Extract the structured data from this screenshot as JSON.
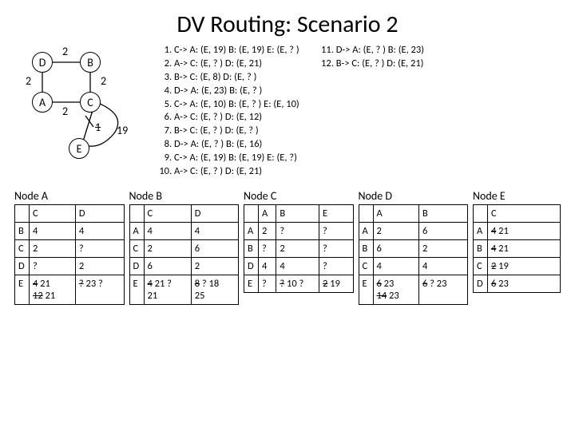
{
  "title": "DV Routing: Scenario 2",
  "graph": {
    "nodes": {
      "D": "D",
      "B": "B",
      "A": "A",
      "C": "C",
      "E": "E"
    },
    "edge_labels": {
      "DB": "2",
      "DA": "2",
      "BC": "2",
      "AC": "2",
      "CE_old": "1",
      "CE_new": "19"
    }
  },
  "steps_left": [
    "C-> A: (E, 19)  B: (E, 19)  E: (E, ? )",
    "A-> C: (E, ? )   D: (E, 21)",
    "B-> C: (E, 8)   D: (E, ? )",
    "D-> A: (E, 23)  B: (E, ? )",
    "C-> A: (E, 10)  B: (E, ? )   E: (E, 10)",
    "A-> C: (E, ? )   D: (E, 12)",
    "B-> C: (E, ? )   D: (E, ? )",
    "D-> A: (E, ? )   B: (E, 16)",
    "C-> A: (E, 19)  B: (E, 19)  E: (E, ?)",
    "A-> C: (E, ? )   D: (E, 21)"
  ],
  "steps_right": [
    "D-> A: (E, ? )   B: (E, 23)",
    "B-> C: (E, ? )   D: (E, 21)"
  ],
  "steps_right_start": 11,
  "tables": {
    "A": {
      "name": "Node A",
      "cols": [
        "C",
        "D"
      ],
      "rows": [
        {
          "h": "B",
          "cells": [
            [
              "4"
            ],
            [
              "4"
            ]
          ]
        },
        {
          "h": "C",
          "cells": [
            [
              "2"
            ],
            [
              "?"
            ]
          ]
        },
        {
          "h": "D",
          "cells": [
            [
              "?"
            ],
            [
              "2"
            ]
          ]
        },
        {
          "h": "E",
          "cells": [
            [
              "~4 21",
              "~12 21"
            ],
            [
              "~? 23 ?"
            ]
          ]
        }
      ]
    },
    "B": {
      "name": "Node B",
      "cols": [
        "C",
        "D"
      ],
      "rows": [
        {
          "h": "A",
          "cells": [
            [
              "4"
            ],
            [
              "4"
            ]
          ]
        },
        {
          "h": "C",
          "cells": [
            [
              "2"
            ],
            [
              "6"
            ]
          ]
        },
        {
          "h": "D",
          "cells": [
            [
              "6"
            ],
            [
              "2"
            ]
          ]
        },
        {
          "h": "E",
          "cells": [
            [
              "~4 21 ?",
              "21"
            ],
            [
              "~8 ? 18",
              "25"
            ]
          ]
        }
      ]
    },
    "C": {
      "name": "Node C",
      "cols": [
        "A",
        "B",
        "E"
      ],
      "rows": [
        {
          "h": "A",
          "cells": [
            [
              "2"
            ],
            [
              "?"
            ],
            [
              "?"
            ]
          ]
        },
        {
          "h": "B",
          "cells": [
            [
              "?"
            ],
            [
              "2"
            ],
            [
              "?"
            ]
          ]
        },
        {
          "h": "D",
          "cells": [
            [
              "4"
            ],
            [
              "4"
            ],
            [
              "?"
            ]
          ]
        },
        {
          "h": "E",
          "cells": [
            [
              "?"
            ],
            [
              "~? 10 ?"
            ],
            [
              "~2 19"
            ]
          ]
        }
      ]
    },
    "D": {
      "name": "Node D",
      "cols": [
        "A",
        "B"
      ],
      "rows": [
        {
          "h": "A",
          "cells": [
            [
              "2"
            ],
            [
              "6"
            ]
          ]
        },
        {
          "h": "B",
          "cells": [
            [
              "6"
            ],
            [
              "2"
            ]
          ]
        },
        {
          "h": "C",
          "cells": [
            [
              "4"
            ],
            [
              "4"
            ]
          ]
        },
        {
          "h": "E",
          "cells": [
            [
              "~6 23",
              "~14 23"
            ],
            [
              "~6 ? 23"
            ]
          ]
        }
      ]
    },
    "E": {
      "name": "Node E",
      "cols": [
        "C"
      ],
      "rows": [
        {
          "h": "A",
          "cells": [
            [
              "~4 21"
            ]
          ]
        },
        {
          "h": "B",
          "cells": [
            [
              "~4 21"
            ]
          ]
        },
        {
          "h": "C",
          "cells": [
            [
              "~2 19"
            ]
          ]
        },
        {
          "h": "D",
          "cells": [
            [
              "~6 23"
            ]
          ]
        }
      ]
    }
  }
}
